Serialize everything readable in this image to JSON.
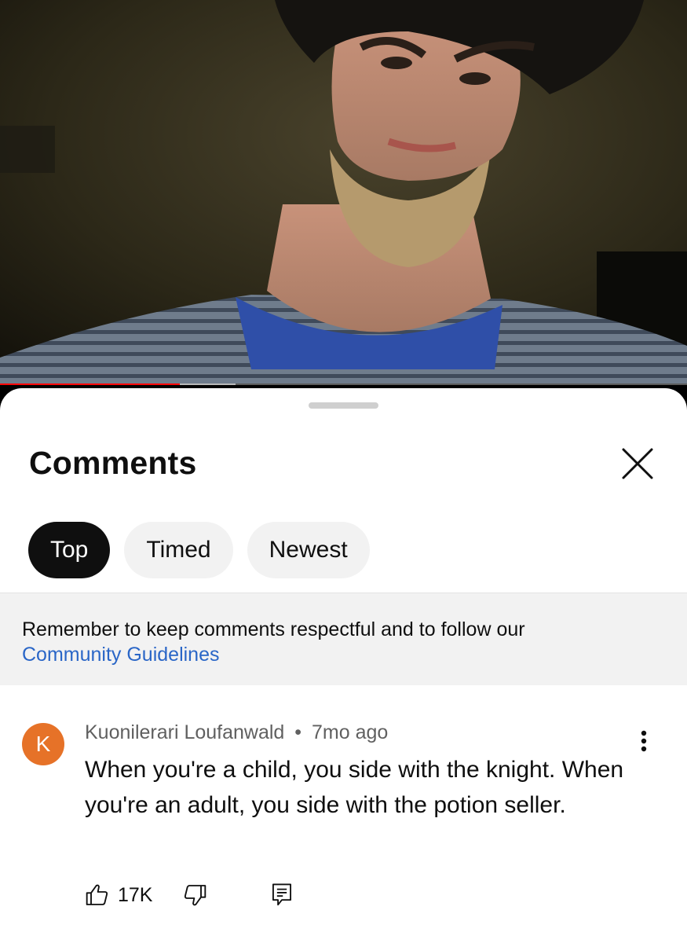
{
  "video": {
    "progress_played": 0.262,
    "progress_buffered": 0.343
  },
  "comments_panel": {
    "title": "Comments",
    "close_icon": "close-icon",
    "sort_chips": [
      {
        "label": "Top",
        "active": true
      },
      {
        "label": "Timed",
        "active": false
      },
      {
        "label": "Newest",
        "active": false
      }
    ],
    "notice": {
      "text": "Remember to keep comments respectful and to follow our",
      "link": "Community Guidelines"
    }
  },
  "comment": {
    "avatar_letter": "K",
    "avatar_color": "#e67228",
    "author": "Kuonilerari Loufanwald",
    "separator": "•",
    "time": "7mo ago",
    "text": "When you're a child, you side with the knight. When you're an adult, you side with the potion seller.",
    "likes": "17K",
    "icons": [
      "thumbs-up-icon",
      "thumbs-down-icon",
      "reply-icon",
      "more-vert-icon"
    ]
  },
  "colors": {
    "progress_red": "#ff0000",
    "link_blue": "#2a66c7",
    "chip_active": "#0f0f0f",
    "chip_inactive": "#f2f2f2"
  }
}
